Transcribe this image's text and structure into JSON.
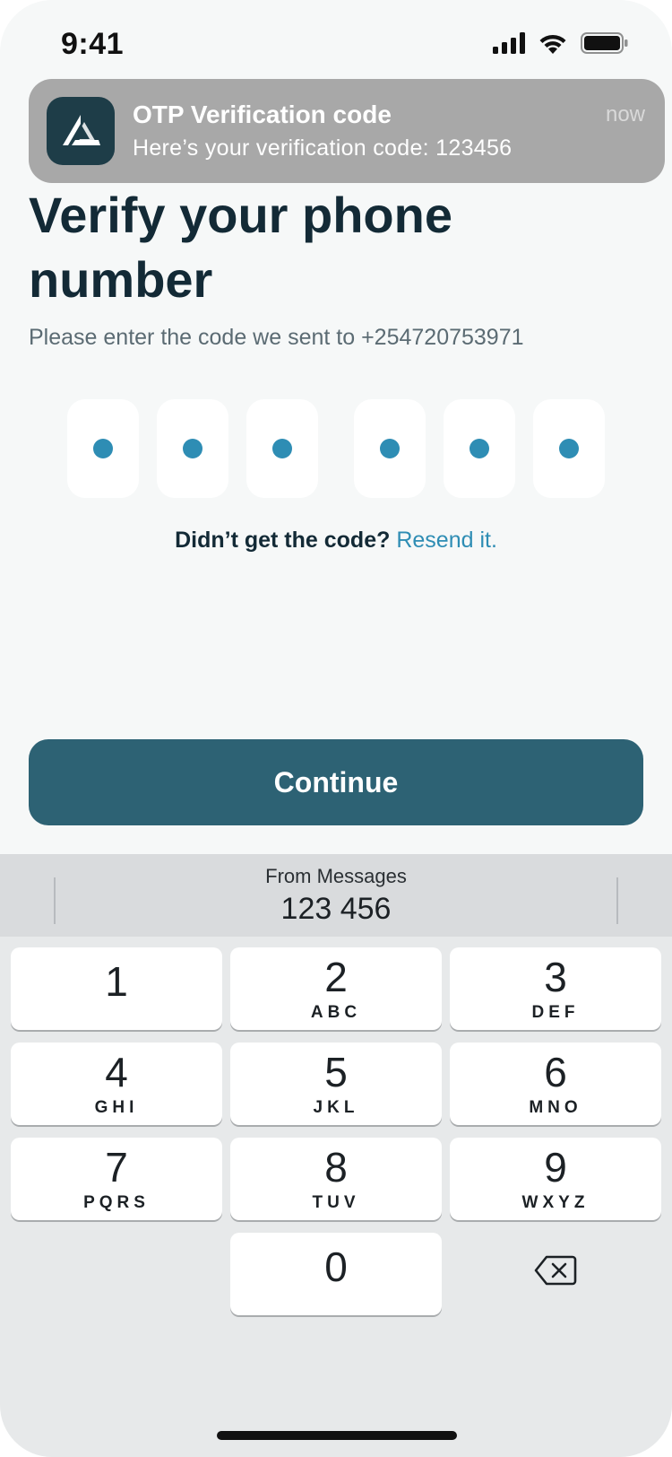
{
  "status_bar": {
    "time": "9:41"
  },
  "notification": {
    "title": "OTP Verification code",
    "body": "Here’s your verification code: 123456",
    "time": "now"
  },
  "page": {
    "title": "Verify your phone number",
    "subtitle": "Please enter the code we sent to +254720753971",
    "otp_digits_filled": 6,
    "resend_question": "Didn’t get the code?",
    "resend_link": "Resend it.",
    "continue_label": "Continue"
  },
  "keyboard": {
    "suggestion_source": "From Messages",
    "suggestion_code": "123 456",
    "keys": [
      {
        "num": "1",
        "letters": ""
      },
      {
        "num": "2",
        "letters": "ABC"
      },
      {
        "num": "3",
        "letters": "DEF"
      },
      {
        "num": "4",
        "letters": "GHI"
      },
      {
        "num": "5",
        "letters": "JKL"
      },
      {
        "num": "6",
        "letters": "MNO"
      },
      {
        "num": "7",
        "letters": "PQRS"
      },
      {
        "num": "8",
        "letters": "TUV"
      },
      {
        "num": "9",
        "letters": "WXYZ"
      },
      {
        "num": "0",
        "letters": ""
      }
    ],
    "delete_icon": "backspace-icon"
  },
  "colors": {
    "accent": "#2e8db4",
    "button": "#2d6274",
    "title_text": "#132a36"
  }
}
